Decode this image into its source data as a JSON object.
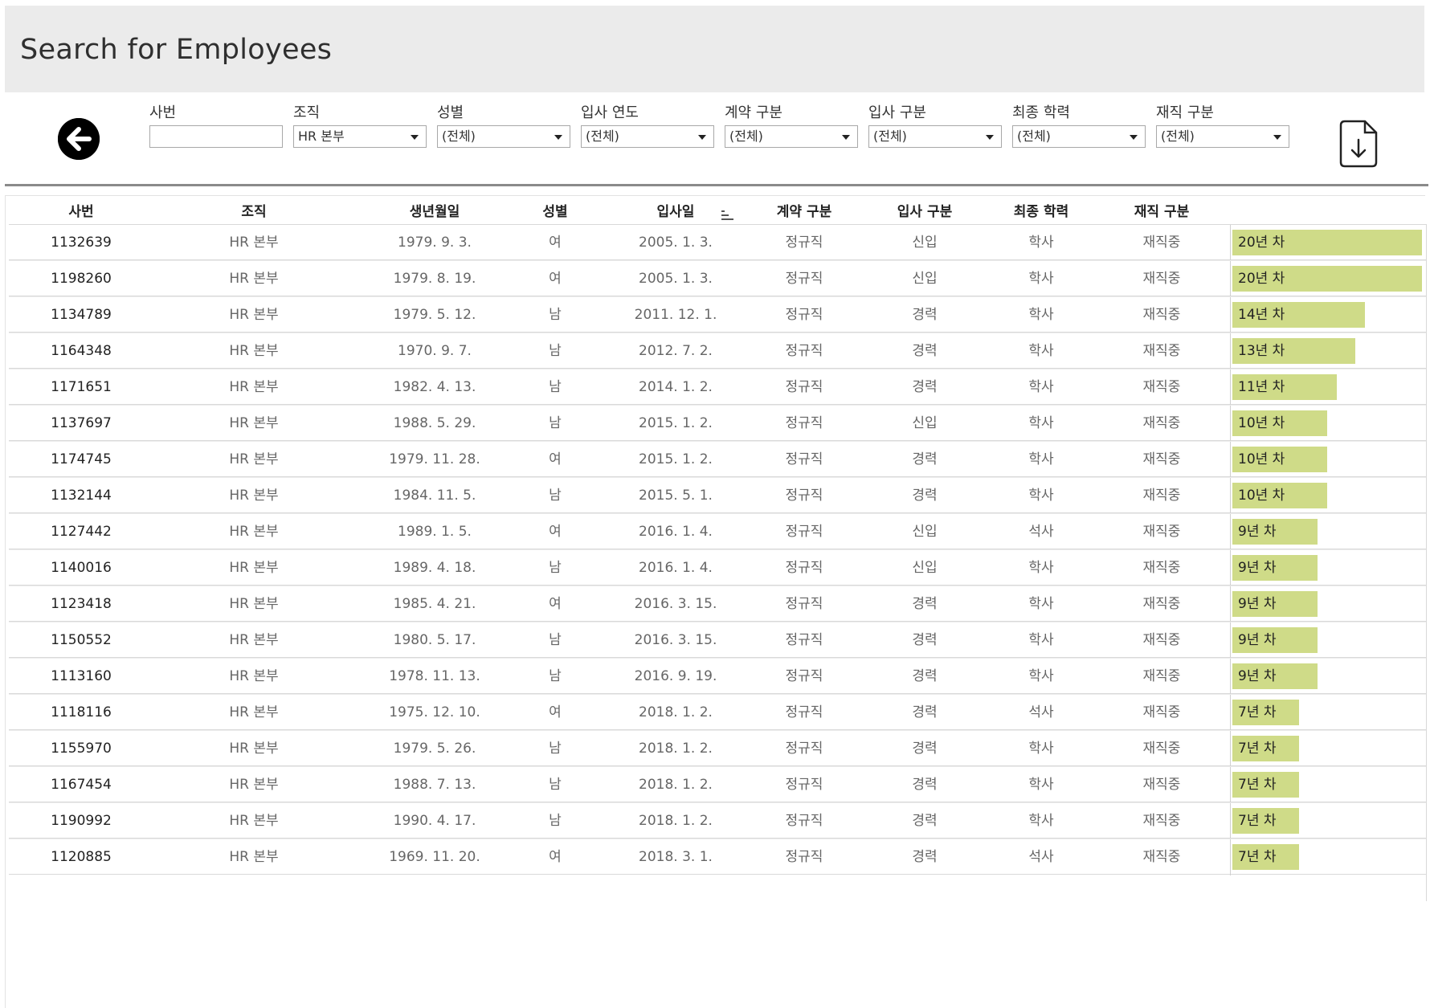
{
  "header": {
    "title": "Search for Employees"
  },
  "filters": [
    {
      "label": "사번",
      "value": "",
      "dropdown": false
    },
    {
      "label": "조직",
      "value": "HR 본부",
      "dropdown": true
    },
    {
      "label": "성별",
      "value": "(전체)",
      "dropdown": true
    },
    {
      "label": "입사 연도",
      "value": "(전체)",
      "dropdown": true
    },
    {
      "label": "계약 구분",
      "value": "(전체)",
      "dropdown": true
    },
    {
      "label": "입사 구분",
      "value": "(전체)",
      "dropdown": true
    },
    {
      "label": "최종 학력",
      "value": "(전체)",
      "dropdown": true
    },
    {
      "label": "재직 구분",
      "value": "(전체)",
      "dropdown": true
    }
  ],
  "icons": {
    "back": "arrow-left-circle-icon",
    "download": "file-download-icon",
    "sort": "sort-descending-icon"
  },
  "colors": {
    "bar": "#cfdb88",
    "header_bg": "#ebebeb"
  },
  "table": {
    "columns": [
      "사번",
      "조직",
      "생년월일",
      "성별",
      "입사일",
      "계약 구분",
      "입사 구분",
      "최종 학력",
      "재직 구분"
    ],
    "bar_max_years": 20,
    "rows": [
      {
        "id": "1132639",
        "org": "HR 본부",
        "birth": "1979. 9. 3.",
        "gender": "여",
        "hire": "2005. 1. 3.",
        "contract": "정규직",
        "entry": "신입",
        "edu": "학사",
        "status": "재직중",
        "years": 20,
        "tenure": "20년 차"
      },
      {
        "id": "1198260",
        "org": "HR 본부",
        "birth": "1979. 8. 19.",
        "gender": "여",
        "hire": "2005. 1. 3.",
        "contract": "정규직",
        "entry": "신입",
        "edu": "학사",
        "status": "재직중",
        "years": 20,
        "tenure": "20년 차"
      },
      {
        "id": "1134789",
        "org": "HR 본부",
        "birth": "1979. 5. 12.",
        "gender": "남",
        "hire": "2011. 12. 1.",
        "contract": "정규직",
        "entry": "경력",
        "edu": "학사",
        "status": "재직중",
        "years": 14,
        "tenure": "14년 차"
      },
      {
        "id": "1164348",
        "org": "HR 본부",
        "birth": "1970. 9. 7.",
        "gender": "남",
        "hire": "2012. 7. 2.",
        "contract": "정규직",
        "entry": "경력",
        "edu": "학사",
        "status": "재직중",
        "years": 13,
        "tenure": "13년 차"
      },
      {
        "id": "1171651",
        "org": "HR 본부",
        "birth": "1982. 4. 13.",
        "gender": "남",
        "hire": "2014. 1. 2.",
        "contract": "정규직",
        "entry": "경력",
        "edu": "학사",
        "status": "재직중",
        "years": 11,
        "tenure": "11년 차"
      },
      {
        "id": "1137697",
        "org": "HR 본부",
        "birth": "1988. 5. 29.",
        "gender": "남",
        "hire": "2015. 1. 2.",
        "contract": "정규직",
        "entry": "신입",
        "edu": "학사",
        "status": "재직중",
        "years": 10,
        "tenure": "10년 차"
      },
      {
        "id": "1174745",
        "org": "HR 본부",
        "birth": "1979. 11. 28.",
        "gender": "여",
        "hire": "2015. 1. 2.",
        "contract": "정규직",
        "entry": "경력",
        "edu": "학사",
        "status": "재직중",
        "years": 10,
        "tenure": "10년 차"
      },
      {
        "id": "1132144",
        "org": "HR 본부",
        "birth": "1984. 11. 5.",
        "gender": "남",
        "hire": "2015. 5. 1.",
        "contract": "정규직",
        "entry": "경력",
        "edu": "학사",
        "status": "재직중",
        "years": 10,
        "tenure": "10년 차"
      },
      {
        "id": "1127442",
        "org": "HR 본부",
        "birth": "1989. 1. 5.",
        "gender": "여",
        "hire": "2016. 1. 4.",
        "contract": "정규직",
        "entry": "신입",
        "edu": "석사",
        "status": "재직중",
        "years": 9,
        "tenure": "9년 차"
      },
      {
        "id": "1140016",
        "org": "HR 본부",
        "birth": "1989. 4. 18.",
        "gender": "남",
        "hire": "2016. 1. 4.",
        "contract": "정규직",
        "entry": "신입",
        "edu": "학사",
        "status": "재직중",
        "years": 9,
        "tenure": "9년 차"
      },
      {
        "id": "1123418",
        "org": "HR 본부",
        "birth": "1985. 4. 21.",
        "gender": "여",
        "hire": "2016. 3. 15.",
        "contract": "정규직",
        "entry": "경력",
        "edu": "학사",
        "status": "재직중",
        "years": 9,
        "tenure": "9년 차"
      },
      {
        "id": "1150552",
        "org": "HR 본부",
        "birth": "1980. 5. 17.",
        "gender": "남",
        "hire": "2016. 3. 15.",
        "contract": "정규직",
        "entry": "경력",
        "edu": "학사",
        "status": "재직중",
        "years": 9,
        "tenure": "9년 차"
      },
      {
        "id": "1113160",
        "org": "HR 본부",
        "birth": "1978. 11. 13.",
        "gender": "남",
        "hire": "2016. 9. 19.",
        "contract": "정규직",
        "entry": "경력",
        "edu": "학사",
        "status": "재직중",
        "years": 9,
        "tenure": "9년 차"
      },
      {
        "id": "1118116",
        "org": "HR 본부",
        "birth": "1975. 12. 10.",
        "gender": "여",
        "hire": "2018. 1. 2.",
        "contract": "정규직",
        "entry": "경력",
        "edu": "석사",
        "status": "재직중",
        "years": 7,
        "tenure": "7년 차"
      },
      {
        "id": "1155970",
        "org": "HR 본부",
        "birth": "1979. 5. 26.",
        "gender": "남",
        "hire": "2018. 1. 2.",
        "contract": "정규직",
        "entry": "경력",
        "edu": "학사",
        "status": "재직중",
        "years": 7,
        "tenure": "7년 차"
      },
      {
        "id": "1167454",
        "org": "HR 본부",
        "birth": "1988. 7. 13.",
        "gender": "남",
        "hire": "2018. 1. 2.",
        "contract": "정규직",
        "entry": "경력",
        "edu": "학사",
        "status": "재직중",
        "years": 7,
        "tenure": "7년 차"
      },
      {
        "id": "1190992",
        "org": "HR 본부",
        "birth": "1990. 4. 17.",
        "gender": "남",
        "hire": "2018. 1. 2.",
        "contract": "정규직",
        "entry": "경력",
        "edu": "학사",
        "status": "재직중",
        "years": 7,
        "tenure": "7년 차"
      },
      {
        "id": "1120885",
        "org": "HR 본부",
        "birth": "1969. 11. 20.",
        "gender": "여",
        "hire": "2018. 3. 1.",
        "contract": "정규직",
        "entry": "경력",
        "edu": "석사",
        "status": "재직중",
        "years": 7,
        "tenure": "7년 차"
      }
    ]
  }
}
